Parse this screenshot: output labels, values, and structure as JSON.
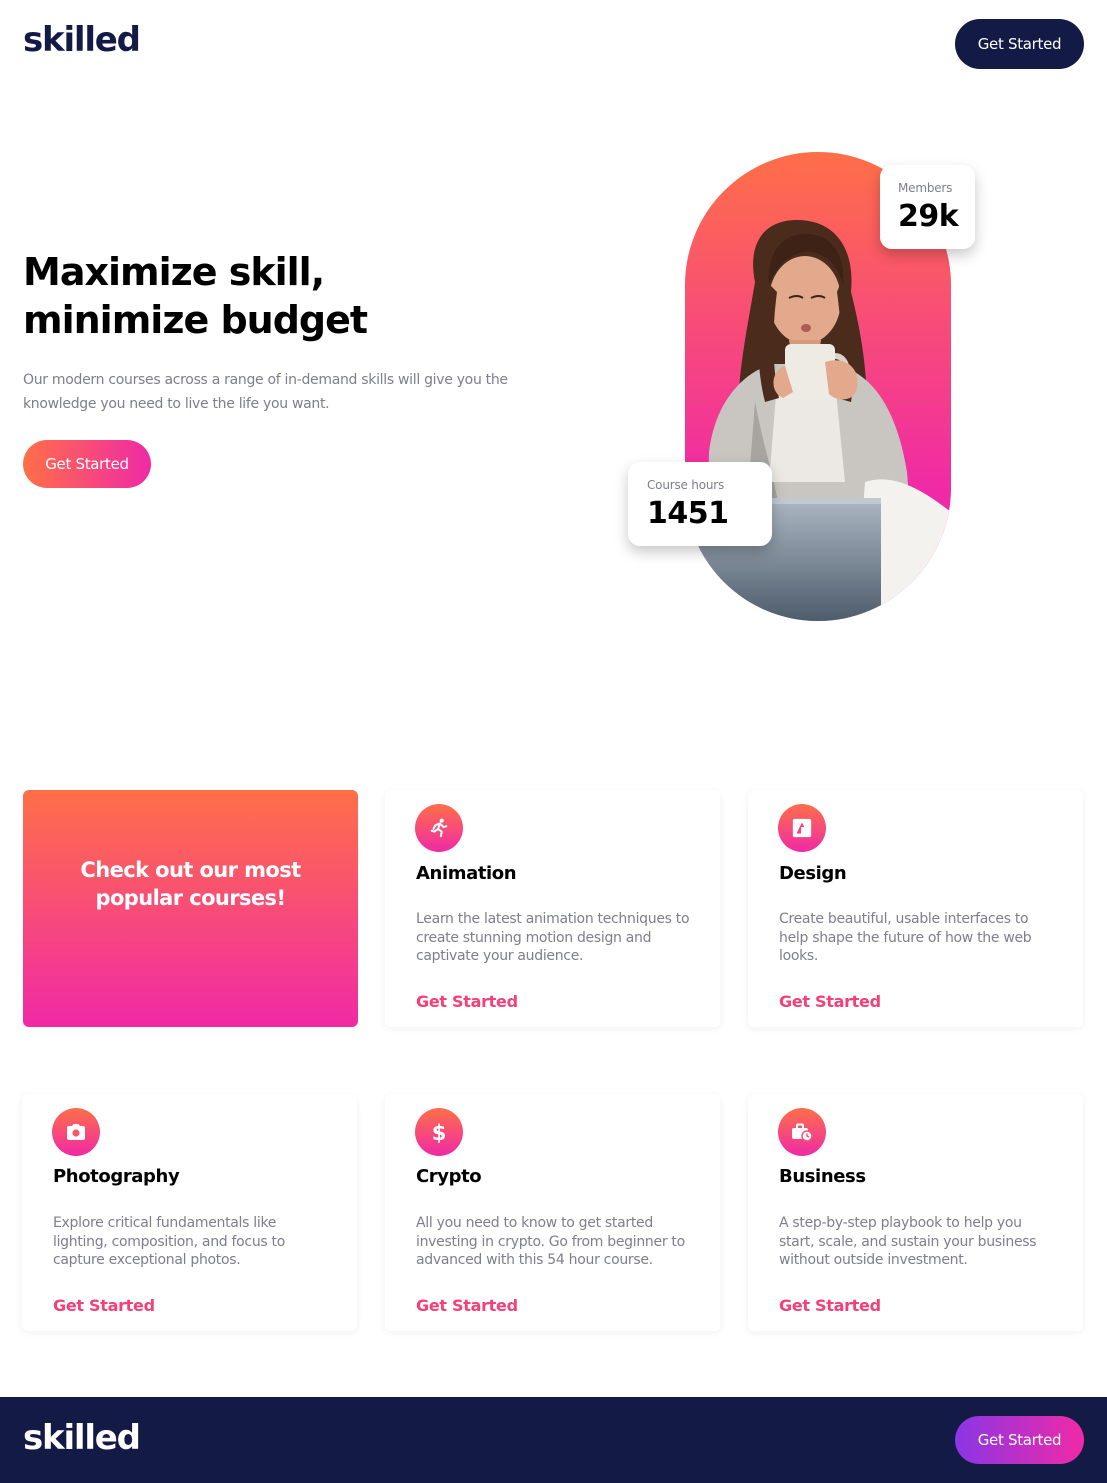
{
  "header": {
    "logo": "skilled",
    "cta_label": "Get Started"
  },
  "hero": {
    "title": "Maximize skill, minimize budget",
    "text": "Our modern courses across a range of in-demand skills will give you the knowledge you need to live the life you want.",
    "cta_label": "Get Started",
    "stats": {
      "members": {
        "label": "Members",
        "value": "29k"
      },
      "course_hours": {
        "label": "Course hours",
        "value": "1451"
      }
    }
  },
  "courses": {
    "promo_text": "Check out our most popular courses!",
    "link_label": "Get Started",
    "items": [
      {
        "title": "Animation",
        "icon": "running-person-icon",
        "desc": "Learn the latest animation techniques to create stunning motion design and captivate your audience."
      },
      {
        "title": "Design",
        "icon": "design-frame-icon",
        "desc": "Create beautiful, usable interfaces to help shape the future of how the web looks."
      },
      {
        "title": "Photography",
        "icon": "camera-icon",
        "desc": "Explore critical fundamentals like lighting, composition, and focus to capture exceptional photos."
      },
      {
        "title": "Crypto",
        "icon": "dollar-icon",
        "desc": "All you need to know to get started investing in crypto. Go from beginner to advanced with this 54 hour course."
      },
      {
        "title": "Business",
        "icon": "briefcase-clock-icon",
        "desc": "A step-by-step playbook to help you start, scale, and sustain your business without outside investment."
      }
    ]
  },
  "footer": {
    "logo": "skilled",
    "cta_label": "Get Started"
  },
  "colors": {
    "navy": "#141a46",
    "gradient_start": "#ff6f48",
    "gradient_end": "#f02aa6",
    "link": "#f43f78",
    "muted_text": "#7e7e8c"
  }
}
